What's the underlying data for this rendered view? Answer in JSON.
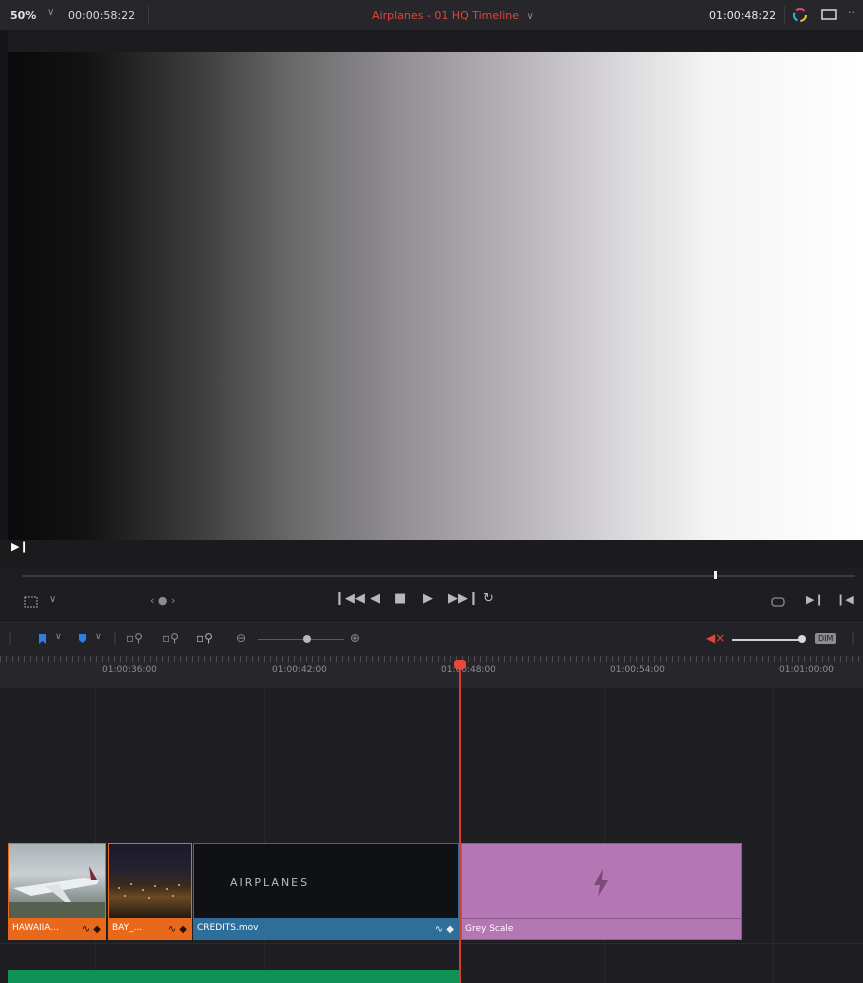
{
  "viewer": {
    "zoom_label": "50%",
    "source_timecode": "00:00:58:22",
    "timeline_title": "Airplanes - 01 HQ Timeline",
    "record_timecode": "01:00:48:22"
  },
  "timeline": {
    "ruler_ticks": [
      "01:00:36:00",
      "01:00:42:00",
      "01:00:48:00",
      "01:00:54:00",
      "01:01:00:00"
    ],
    "clips": [
      {
        "name": "HAWAIIA...",
        "color": "#e8691c"
      },
      {
        "name": "BAY_...",
        "color": "#e8691c"
      },
      {
        "name": "CREDITS.mov",
        "color": "#2d6f9a",
        "overlay_text": "AIRPLANES"
      },
      {
        "name": "Grey Scale",
        "color": "#b477b4"
      }
    ],
    "audio_clip_color": "#109257",
    "volume_button_label": "DIM"
  },
  "icons": {
    "zoom_chevron": "chevron-down-icon",
    "color_wheel": "color-wheel-icon",
    "monitor": "monitor-icon",
    "more": "more-options-icon",
    "transform": "transform-icon",
    "jog": "jog-wheel-icon",
    "jump_start": "jump-to-start-icon",
    "play_reverse": "play-reverse-icon",
    "stop": "stop-icon",
    "play": "play-icon",
    "jump_end": "jump-to-end-icon",
    "loop": "loop-icon",
    "match_frame": "match-frame-icon",
    "flag": "flag-icon",
    "marker": "marker-icon",
    "zoom_full": "zoom-full-icon",
    "zoom_detail": "zoom-detail-icon",
    "zoom_custom": "zoom-custom-icon",
    "mute": "mute-icon",
    "lightning": "lightning-icon"
  },
  "colors": {
    "accent_red": "#e0453a",
    "playhead": "#d4402f"
  }
}
